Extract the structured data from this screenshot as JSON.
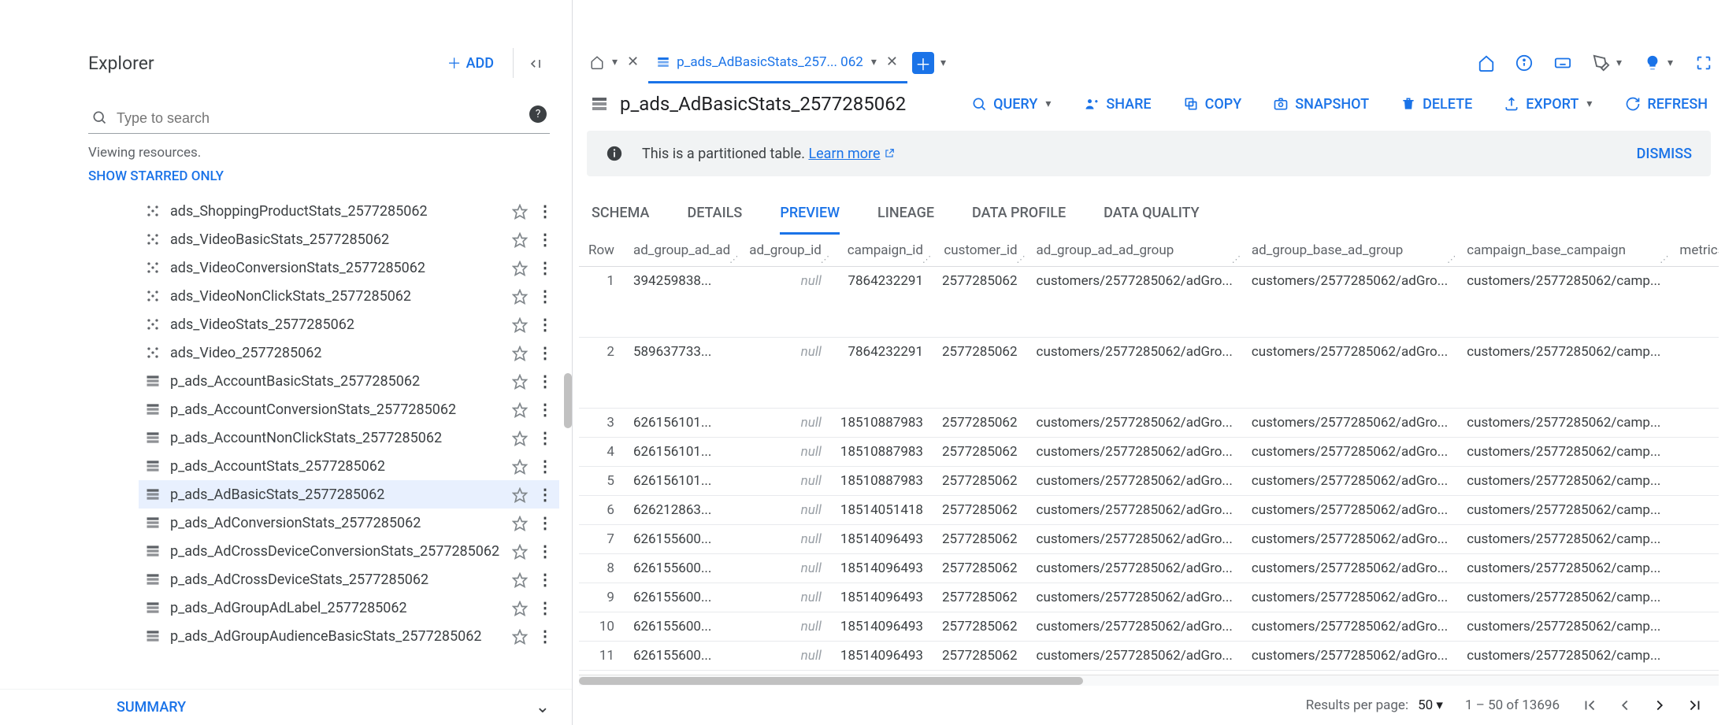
{
  "explorer": {
    "title": "Explorer",
    "add_label": "ADD",
    "search_placeholder": "Type to search",
    "viewing_label": "Viewing resources.",
    "starred_label": "SHOW STARRED ONLY",
    "summary_label": "SUMMARY",
    "items": [
      {
        "label": "ads_ShoppingProductStats_2577285062",
        "type": "model"
      },
      {
        "label": "ads_VideoBasicStats_2577285062",
        "type": "model"
      },
      {
        "label": "ads_VideoConversionStats_2577285062",
        "type": "model"
      },
      {
        "label": "ads_VideoNonClickStats_2577285062",
        "type": "model"
      },
      {
        "label": "ads_VideoStats_2577285062",
        "type": "model"
      },
      {
        "label": "ads_Video_2577285062",
        "type": "model"
      },
      {
        "label": "p_ads_AccountBasicStats_2577285062",
        "type": "table"
      },
      {
        "label": "p_ads_AccountConversionStats_2577285062",
        "type": "table"
      },
      {
        "label": "p_ads_AccountNonClickStats_2577285062",
        "type": "table"
      },
      {
        "label": "p_ads_AccountStats_2577285062",
        "type": "table"
      },
      {
        "label": "p_ads_AdBasicStats_2577285062",
        "type": "table",
        "selected": true
      },
      {
        "label": "p_ads_AdConversionStats_2577285062",
        "type": "table"
      },
      {
        "label": "p_ads_AdCrossDeviceConversionStats_2577285062",
        "type": "table"
      },
      {
        "label": "p_ads_AdCrossDeviceStats_2577285062",
        "type": "table"
      },
      {
        "label": "p_ads_AdGroupAdLabel_2577285062",
        "type": "table"
      },
      {
        "label": "p_ads_AdGroupAudienceBasicStats_2577285062",
        "type": "table"
      }
    ]
  },
  "tabs": {
    "home_close": "✕",
    "active_label": "p_ads_AdBasicStats_257... 062",
    "active_close": "✕"
  },
  "title": {
    "text": "p_ads_AdBasicStats_2577285062"
  },
  "actions": {
    "query": "QUERY",
    "share": "SHARE",
    "copy": "COPY",
    "snapshot": "SNAPSHOT",
    "delete": "DELETE",
    "export": "EXPORT",
    "refresh": "REFRESH"
  },
  "banner": {
    "text": "This is a partitioned table.",
    "link": "Learn more",
    "dismiss": "DISMISS"
  },
  "subtabs": {
    "schema": "SCHEMA",
    "details": "DETAILS",
    "preview": "PREVIEW",
    "lineage": "LINEAGE",
    "data_profile": "DATA PROFILE",
    "data_quality": "DATA QUALITY"
  },
  "grid": {
    "columns": [
      "Row",
      "ad_group_ad_ad",
      "ad_group_id",
      "campaign_id",
      "customer_id",
      "ad_group_ad_ad_group",
      "ad_group_base_ad_group",
      "campaign_base_campaign",
      "metrics_cl"
    ],
    "rows": [
      {
        "row": "1",
        "c1": "394259838...",
        "c2": "null",
        "c3": "7864232291",
        "c4": "2577285062",
        "c5": "customers/2577285062/adGro...",
        "c6": "customers/2577285062/adGro...",
        "c7": "customers/2577285062/camp...",
        "tall": true
      },
      {
        "row": "2",
        "c1": "589637733...",
        "c2": "null",
        "c3": "7864232291",
        "c4": "2577285062",
        "c5": "customers/2577285062/adGro...",
        "c6": "customers/2577285062/adGro...",
        "c7": "customers/2577285062/camp...",
        "tall": true
      },
      {
        "row": "3",
        "c1": "626156101...",
        "c2": "null",
        "c3": "18510887983",
        "c4": "2577285062",
        "c5": "customers/2577285062/adGro...",
        "c6": "customers/2577285062/adGro...",
        "c7": "customers/2577285062/camp..."
      },
      {
        "row": "4",
        "c1": "626156101...",
        "c2": "null",
        "c3": "18510887983",
        "c4": "2577285062",
        "c5": "customers/2577285062/adGro...",
        "c6": "customers/2577285062/adGro...",
        "c7": "customers/2577285062/camp..."
      },
      {
        "row": "5",
        "c1": "626156101...",
        "c2": "null",
        "c3": "18510887983",
        "c4": "2577285062",
        "c5": "customers/2577285062/adGro...",
        "c6": "customers/2577285062/adGro...",
        "c7": "customers/2577285062/camp..."
      },
      {
        "row": "6",
        "c1": "626212863...",
        "c2": "null",
        "c3": "18514051418",
        "c4": "2577285062",
        "c5": "customers/2577285062/adGro...",
        "c6": "customers/2577285062/adGro...",
        "c7": "customers/2577285062/camp..."
      },
      {
        "row": "7",
        "c1": "626155600...",
        "c2": "null",
        "c3": "18514096493",
        "c4": "2577285062",
        "c5": "customers/2577285062/adGro...",
        "c6": "customers/2577285062/adGro...",
        "c7": "customers/2577285062/camp..."
      },
      {
        "row": "8",
        "c1": "626155600...",
        "c2": "null",
        "c3": "18514096493",
        "c4": "2577285062",
        "c5": "customers/2577285062/adGro...",
        "c6": "customers/2577285062/adGro...",
        "c7": "customers/2577285062/camp..."
      },
      {
        "row": "9",
        "c1": "626155600...",
        "c2": "null",
        "c3": "18514096493",
        "c4": "2577285062",
        "c5": "customers/2577285062/adGro...",
        "c6": "customers/2577285062/adGro...",
        "c7": "customers/2577285062/camp..."
      },
      {
        "row": "10",
        "c1": "626155600...",
        "c2": "null",
        "c3": "18514096493",
        "c4": "2577285062",
        "c5": "customers/2577285062/adGro...",
        "c6": "customers/2577285062/adGro...",
        "c7": "customers/2577285062/camp..."
      },
      {
        "row": "11",
        "c1": "626155600...",
        "c2": "null",
        "c3": "18514096493",
        "c4": "2577285062",
        "c5": "customers/2577285062/adGro...",
        "c6": "customers/2577285062/adGro...",
        "c7": "customers/2577285062/camp..."
      }
    ]
  },
  "footer": {
    "rpp_label": "Results per page:",
    "rpp_value": "50",
    "range": "1 – 50 of 13696"
  }
}
